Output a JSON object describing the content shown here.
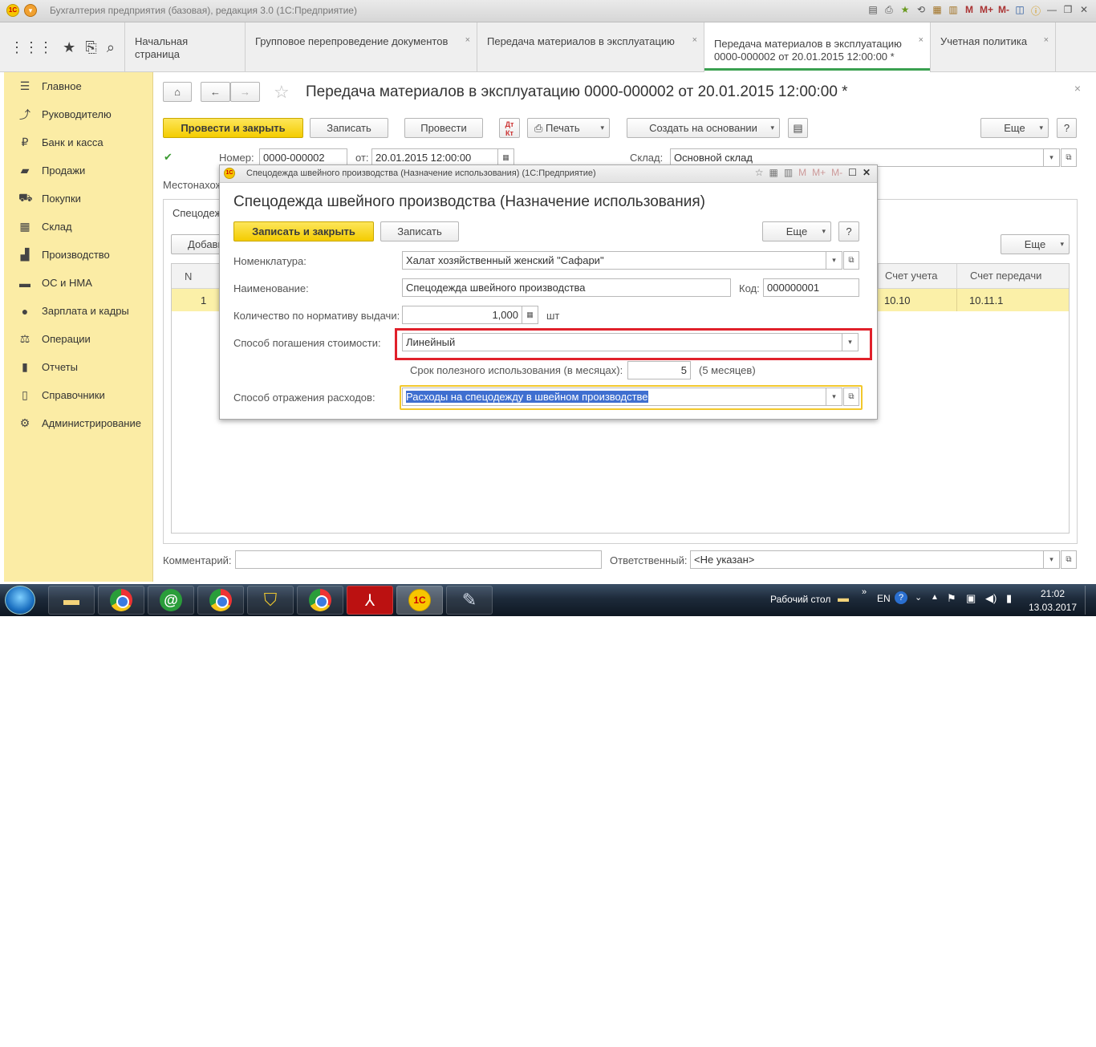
{
  "window": {
    "title": "Бухгалтерия предприятия (базовая), редакция 3.0  (1С:Предприятие)",
    "toolbar_icons": [
      "M",
      "M+",
      "M-"
    ]
  },
  "tabs": [
    {
      "label": "Начальная страница"
    },
    {
      "label": "Групповое перепроведение документов"
    },
    {
      "label": "Передача материалов в эксплуатацию"
    },
    {
      "label": "Передача материалов в эксплуатацию\n0000-000002 от 20.01.2015 12:00:00 *"
    },
    {
      "label": "Учетная политика"
    }
  ],
  "sidebar": {
    "items": [
      {
        "label": "Главное",
        "icon": "menu-icon"
      },
      {
        "label": "Руководителю",
        "icon": "trend-icon"
      },
      {
        "label": "Банк и касса",
        "icon": "ruble-icon"
      },
      {
        "label": "Продажи",
        "icon": "briefcase-icon"
      },
      {
        "label": "Покупки",
        "icon": "cart-icon"
      },
      {
        "label": "Склад",
        "icon": "grid-icon"
      },
      {
        "label": "Производство",
        "icon": "factory-icon"
      },
      {
        "label": "ОС и НМА",
        "icon": "truck-icon"
      },
      {
        "label": "Зарплата и кадры",
        "icon": "person-icon"
      },
      {
        "label": "Операции",
        "icon": "scales-icon"
      },
      {
        "label": "Отчеты",
        "icon": "chart-icon"
      },
      {
        "label": "Справочники",
        "icon": "book-icon"
      },
      {
        "label": "Администрирование",
        "icon": "gear-icon"
      }
    ]
  },
  "document": {
    "title": "Передача материалов в эксплуатацию 0000-000002 от 20.01.2015 12:00:00 *",
    "buttons": {
      "post_close": "Провести и закрыть",
      "save": "Записать",
      "post": "Провести",
      "print": "Печать",
      "create_based": "Создать на основании",
      "more": "Еще",
      "help": "?"
    },
    "number_label": "Номер:",
    "number": "0000-000002",
    "date_label": "от:",
    "date": "20.01.2015 12:00:00",
    "warehouse_label": "Склад:",
    "warehouse": "Основной склад",
    "location_label": "Местонахож",
    "tab_label": "Спецодеж",
    "add_label": "Добави",
    "more2": "Еще",
    "table": {
      "col_n": "N",
      "col_account": "Счет учета",
      "col_transfer": "Счет передачи",
      "row": {
        "n": "1",
        "account": "10.10",
        "transfer": "10.11.1"
      }
    },
    "comment_label": "Комментарий:",
    "comment": "",
    "responsible_label": "Ответственный:",
    "responsible": "<Не указан>"
  },
  "dialog": {
    "window_title": "Спецодежда швейного производства (Назначение использования)  (1С:Предприятие)",
    "title": "Спецодежда швейного производства (Назначение использования)",
    "buttons": {
      "save_close": "Записать и закрыть",
      "save": "Записать",
      "more": "Еще",
      "help": "?"
    },
    "nomenclature_label": "Номенклатура:",
    "nomenclature": "Халат хозяйственный женский \"Сафари\"",
    "name_label": "Наименование:",
    "name": "Спецодежда швейного производства",
    "code_label": "Код:",
    "code": "000000001",
    "qty_label": "Количество по нормативу выдачи:",
    "qty": "1,000",
    "unit": "шт",
    "method_label": "Способ погашения стоимости:",
    "method": "Линейный",
    "term_label": "Срок полезного использования (в месяцах):",
    "term": "5",
    "term_note": "(5 месяцев)",
    "expense_label": "Способ отражения расходов:",
    "expense": "Расходы на спецодежду в швейном производстве"
  },
  "taskbar": {
    "desktop": "Рабочий стол",
    "lang": "EN",
    "time": "21:02",
    "date": "13.03.2017"
  },
  "colors": {
    "accent_yellow": "#f4cc00",
    "sidebar": "#fbeca5",
    "highlight_red": "#e0202a",
    "row_highlight": "#fbf0a8"
  }
}
